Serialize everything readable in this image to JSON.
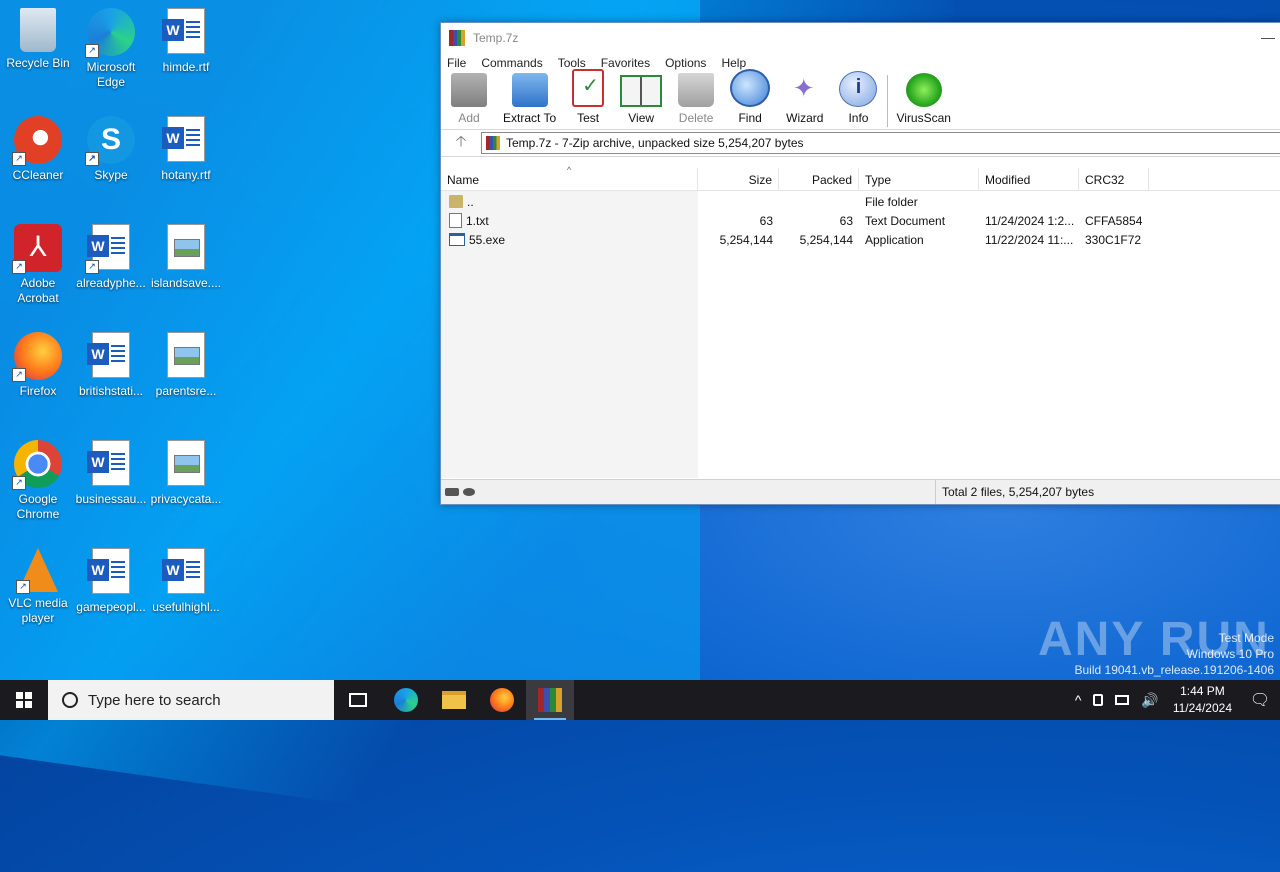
{
  "desktop": {
    "icons": [
      {
        "label": "Recycle Bin",
        "icon": "recycle-bin-icon"
      },
      {
        "label": "Microsoft Edge",
        "icon": "edge-icon"
      },
      {
        "label": "himde.rtf",
        "icon": "word-doc-icon"
      },
      {
        "label": "CCleaner",
        "icon": "ccleaner-icon"
      },
      {
        "label": "Skype",
        "icon": "skype-icon"
      },
      {
        "label": "hotany.rtf",
        "icon": "word-doc-icon"
      },
      {
        "label": "Adobe Acrobat",
        "icon": "acrobat-icon"
      },
      {
        "label": "alreadyphe...",
        "icon": "word-doc-icon"
      },
      {
        "label": "islandsave....",
        "icon": "image-doc-icon"
      },
      {
        "label": "Firefox",
        "icon": "firefox-icon"
      },
      {
        "label": "britishstati...",
        "icon": "word-doc-icon"
      },
      {
        "label": "parentsre...",
        "icon": "image-doc-icon"
      },
      {
        "label": "Google Chrome",
        "icon": "chrome-icon"
      },
      {
        "label": "businessau...",
        "icon": "word-doc-icon"
      },
      {
        "label": "privacycata...",
        "icon": "image-doc-icon"
      },
      {
        "label": "VLC media player",
        "icon": "vlc-icon"
      },
      {
        "label": "gamepeopl...",
        "icon": "word-doc-icon"
      },
      {
        "label": "usefulhighl...",
        "icon": "word-doc-icon"
      }
    ]
  },
  "window": {
    "title": "Temp.7z",
    "minimize_glyph": "—",
    "menu": [
      "File",
      "Commands",
      "Tools",
      "Favorites",
      "Options",
      "Help"
    ],
    "toolbar": [
      {
        "label": "Add",
        "icon": "add-archive-icon",
        "disabled": true
      },
      {
        "label": "Extract To",
        "icon": "extract-folder-icon",
        "disabled": false
      },
      {
        "label": "Test",
        "icon": "test-checklist-icon",
        "disabled": false
      },
      {
        "label": "View",
        "icon": "view-book-icon",
        "disabled": false
      },
      {
        "label": "Delete",
        "icon": "trash-icon",
        "disabled": true
      },
      {
        "label": "Find",
        "icon": "magnifier-icon",
        "disabled": false
      },
      {
        "label": "Wizard",
        "icon": "wand-icon",
        "disabled": false
      },
      {
        "label": "Info",
        "icon": "info-icon",
        "disabled": false
      },
      {
        "label": "VirusScan",
        "icon": "virus-icon",
        "disabled": false
      }
    ],
    "address": "Temp.7z - 7-Zip archive, unpacked size 5,254,207 bytes",
    "up_glyph": "🡡",
    "columns": [
      "Name",
      "Size",
      "Packed",
      "Type",
      "Modified",
      "CRC32"
    ],
    "sort_glyph": "^",
    "rows": [
      {
        "name": "..",
        "size": "",
        "packed": "",
        "type": "File folder",
        "modified": "",
        "crc": "",
        "icon": "folder-icon"
      },
      {
        "name": "1.txt",
        "size": "63",
        "packed": "63",
        "type": "Text Document",
        "modified": "11/24/2024 1:2...",
        "crc": "CFFA5854",
        "icon": "text-file-icon"
      },
      {
        "name": "55.exe",
        "size": "5,254,144",
        "packed": "5,254,144",
        "type": "Application",
        "modified": "11/22/2024 11:...",
        "crc": "330C1F72",
        "icon": "exe-file-icon"
      }
    ],
    "status": "Total 2 files, 5,254,207 bytes"
  },
  "watermark": {
    "brand": "ANY RUN",
    "line1": "Test Mode",
    "line2": "Windows 10 Pro",
    "line3": "Build 19041.vb_release.191206-1406"
  },
  "taskbar": {
    "search_placeholder": "Type here to search",
    "time": "1:44 PM",
    "date": "11/24/2024",
    "tray_glyphs": {
      "chevron": "^",
      "speaker": "🔊",
      "notification": "🗨"
    }
  },
  "colors": {
    "desktop_blue": "#0a8ee8",
    "taskbar": "#1b1b1f",
    "window_border": "#6a8fc0"
  }
}
